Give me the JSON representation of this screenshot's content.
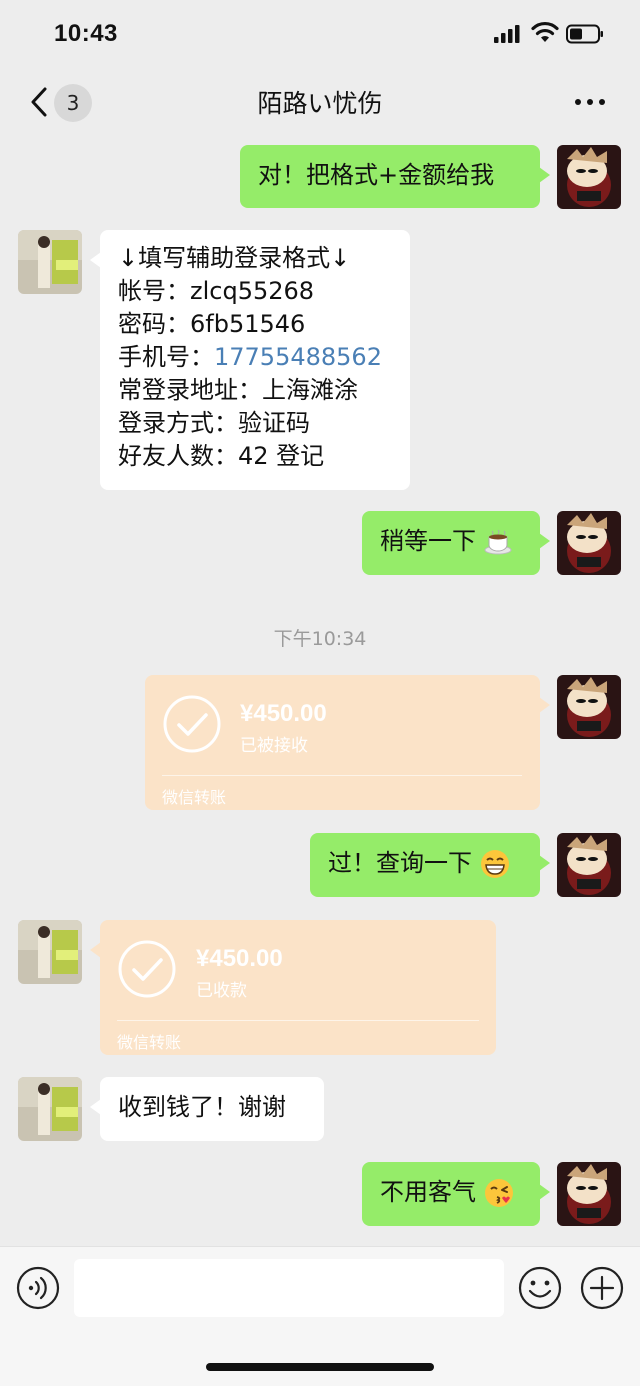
{
  "status_bar": {
    "time": "10:43"
  },
  "nav": {
    "back_badge": "3",
    "title": "陌路い忧伤"
  },
  "messages": {
    "m1": "对！把格式+金额给我",
    "m2_lines": [
      "↓填写辅助登录格式↓",
      "帐号：zlcq55268",
      "密码：6fb51546",
      "手机号：",
      "常登录地址：上海滩涂",
      "登录方式：验证码",
      "好友人数：42 登记"
    ],
    "m2_phone": "17755488562",
    "m3": "稍等一下",
    "timestamp": "下午10:34",
    "transfer1": {
      "amount": "¥450.00",
      "status": "已被接收",
      "footer": "微信转账"
    },
    "m4": "过！查询一下",
    "transfer2": {
      "amount": "¥450.00",
      "status": "已收款",
      "footer": "微信转账"
    },
    "m5": "收到钱了！谢谢",
    "m6": "不用客气"
  },
  "colors": {
    "self_bubble": "#95ec69",
    "other_bubble": "#ffffff",
    "transfer_bubble": "#fbe3c8",
    "background": "#ededed",
    "link": "#4a7fb5"
  },
  "icons": [
    "back-chevron-icon",
    "more-icon",
    "voice-icon",
    "emoji-icon",
    "plus-icon",
    "coffee-emoji-icon",
    "grin-emoji-icon",
    "kiss-emoji-icon",
    "check-circle-icon"
  ]
}
